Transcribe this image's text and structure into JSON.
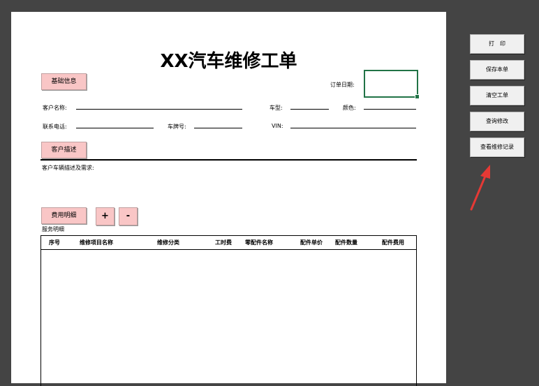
{
  "form": {
    "title": "XX汽车维修工单",
    "basic_info_btn": "基础信息",
    "order_date_label": "订单日期:",
    "customer_name_label": "客户名称:",
    "car_model_label": "车型:",
    "color_label": "颜色:",
    "phone_label": "联系电话:",
    "plate_label": "车牌号:",
    "vin_label": "VIN:",
    "customer_desc_btn": "客户描述",
    "desc_label": "客户车辆描述及需求:",
    "cost_detail_btn": "费用明细",
    "add_btn": "+",
    "remove_btn": "-",
    "service_detail_label": "服务明细"
  },
  "table": {
    "headers": [
      "序号",
      "维修项目名称",
      "维修分类",
      "工时费",
      "零配件名称",
      "配件单价",
      "配件数量",
      "配件费用"
    ]
  },
  "side": {
    "buttons": [
      "打　印",
      "保存本单",
      "清空工单",
      "查询修改",
      "查看维修记录"
    ]
  },
  "colors": {
    "background": "#444444",
    "sheet": "#ffffff",
    "pink_button": "#f9c6c6",
    "selection": "#217346",
    "arrow": "#e53935"
  }
}
